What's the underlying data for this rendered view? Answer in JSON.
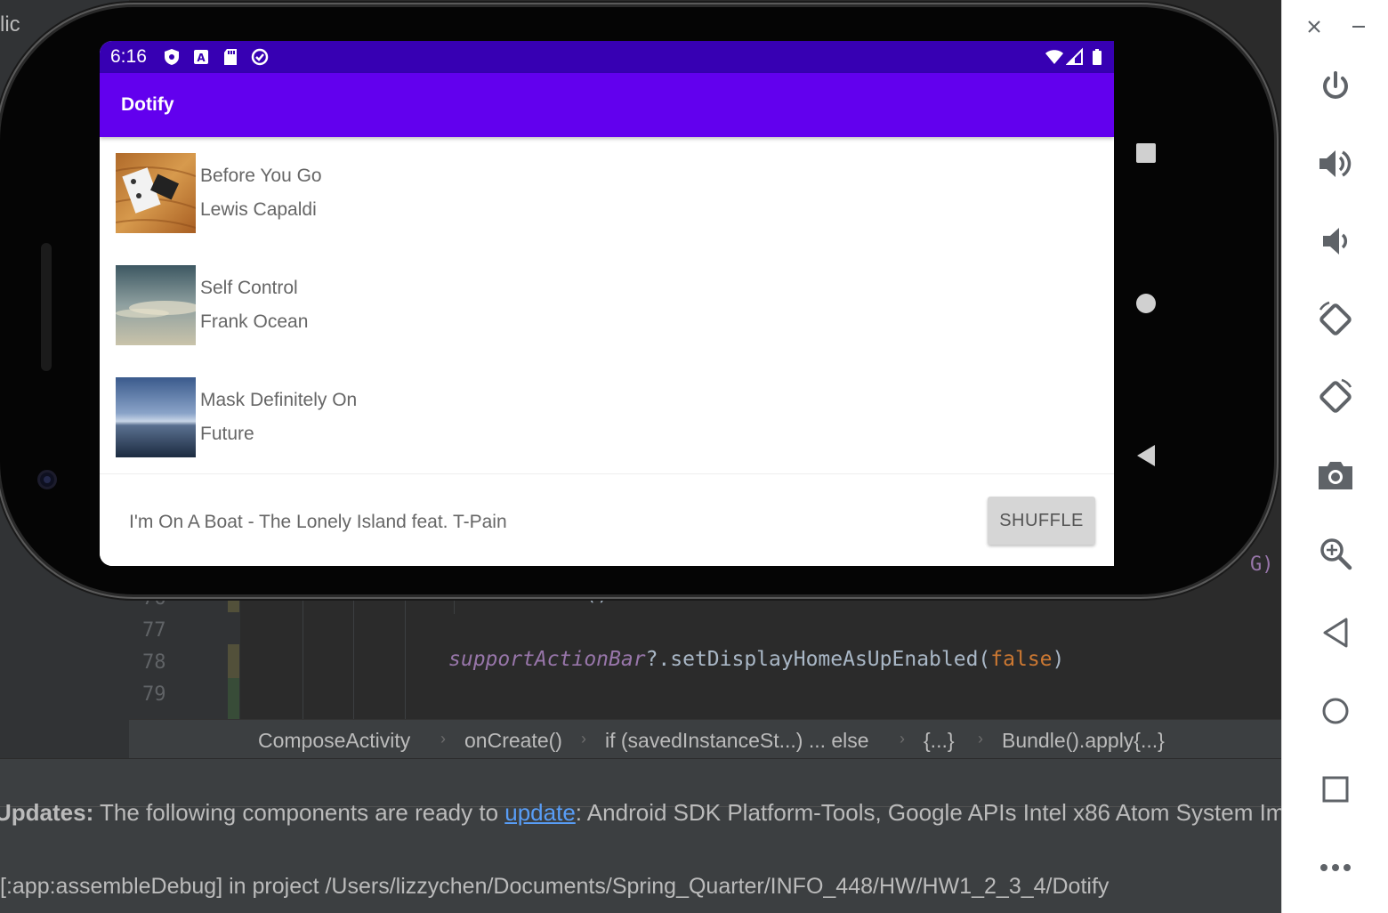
{
  "ide": {
    "top_text": "lic",
    "line_numbers": [
      "76",
      "77",
      "78",
      "79"
    ],
    "code": {
      "line_76": ".commit()",
      "line_78_prop": "supportActionBar",
      "line_78_call": "?.setDisplayHomeAsUpEnabled(",
      "line_78_arg": "false",
      "line_78_close": ")",
      "edge_text": "G)"
    },
    "breadcrumbs": [
      "ComposeActivity",
      "onCreate()",
      "if (savedInstanceSt...) ... else",
      "{...}",
      "Bundle().apply{...}"
    ],
    "notice": {
      "bold": "Updates:",
      "text_before": " The following components are ready to ",
      "link": "update",
      "text_after": ": Android SDK Platform-Tools, Google APIs Intel x86 Atom System Im"
    },
    "build_line": "[:app:assembleDebug] in project /Users/lizzychen/Documents/Spring_Quarter/INFO_448/HW/HW1_2_3_4/Dotify"
  },
  "status_bar": {
    "time": "6:16",
    "icons": [
      "shield-icon",
      "a-badge-icon",
      "sd-card-icon",
      "sync-icon",
      "wifi-icon",
      "signal-icon",
      "battery-icon"
    ]
  },
  "app_bar": {
    "title": "Dotify",
    "color": "#6200ee",
    "status_color": "#3700b3"
  },
  "songs": [
    {
      "title": "Before You Go",
      "artist": "Lewis Capaldi"
    },
    {
      "title": "Self Control",
      "artist": "Frank Ocean"
    },
    {
      "title": "Mask Definitely On",
      "artist": "Future"
    }
  ],
  "mini_player": {
    "now_playing": "I'm On A Boat - The Lonely Island feat. T-Pain",
    "shuffle_label": "SHUFFLE"
  },
  "emulator_toolbar": {
    "items": [
      "power-icon",
      "volume-up-icon",
      "volume-down-icon",
      "rotate-left-icon",
      "rotate-right-icon",
      "camera-icon",
      "zoom-icon",
      "back-icon",
      "home-icon",
      "overview-icon",
      "more-icon"
    ]
  }
}
